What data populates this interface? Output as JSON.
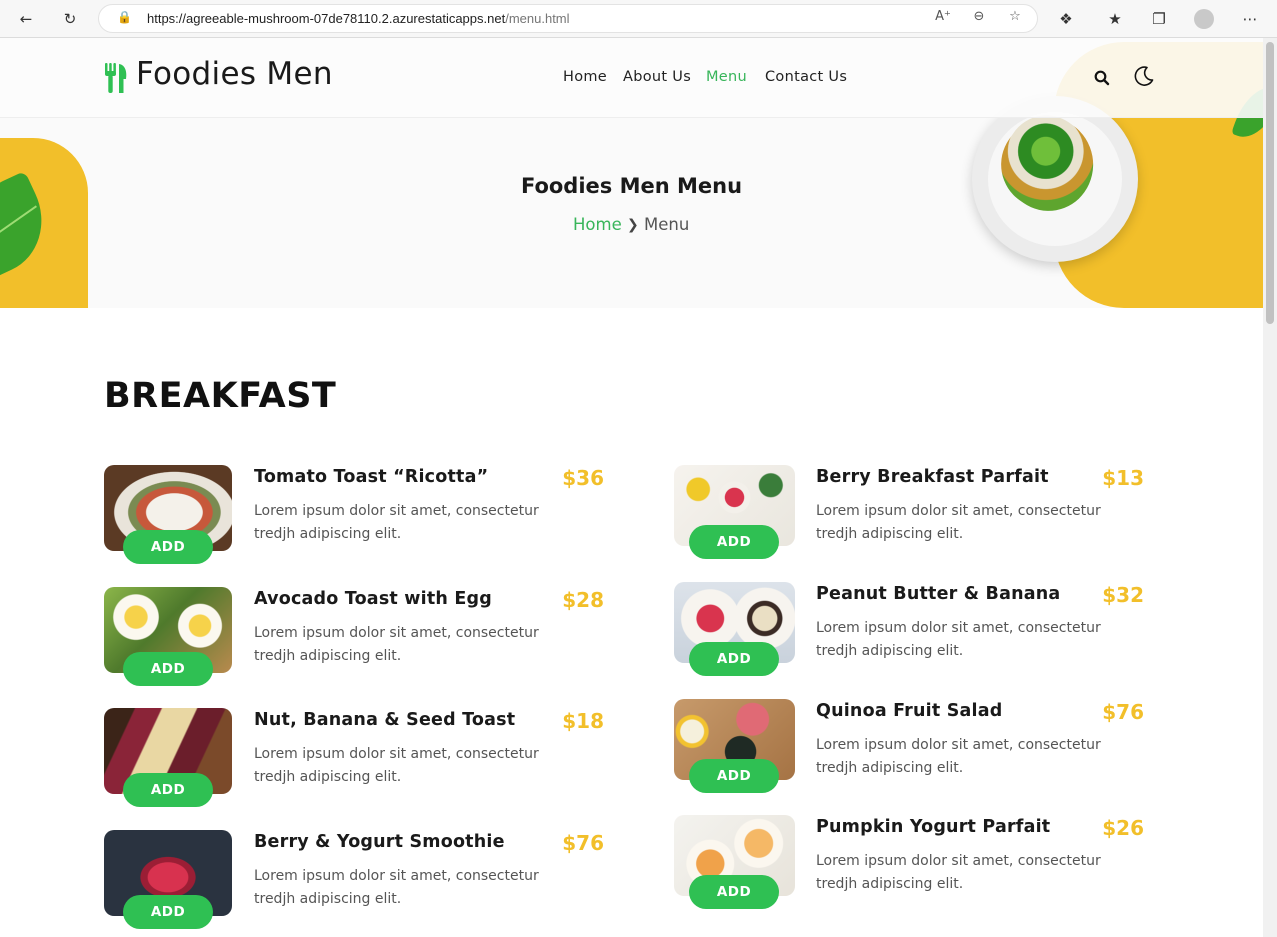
{
  "browser": {
    "url_host": "https://agreeable-mushroom-07de78110.2.azurestaticapps.net",
    "url_path": "/menu.html",
    "icons": [
      "back-icon",
      "refresh-icon",
      "lock-icon",
      "read-aloud-icon",
      "zoom-icon",
      "favorite-add-icon",
      "extensions-icon",
      "favorites-icon",
      "collections-icon",
      "profile-icon",
      "more-icon"
    ]
  },
  "nav": {
    "logo": "Foodies Men",
    "links": [
      "Home",
      "About Us",
      "Menu",
      "Contact Us"
    ],
    "active_link": "Menu"
  },
  "hero": {
    "title": "Foodies Men Menu",
    "breadcrumb_home": "Home",
    "breadcrumb_current": "Menu"
  },
  "menu": {
    "section_title": "BREAKFAST",
    "add_label": "ADD",
    "left": [
      {
        "name": "Tomato Toast “Ricotta”",
        "price": "$36",
        "desc": "Lorem ipsum dolor sit amet, consectetur tredjh adipiscing elit."
      },
      {
        "name": "Avocado Toast with Egg",
        "price": "$28",
        "desc": "Lorem ipsum dolor sit amet, consectetur tredjh adipiscing elit."
      },
      {
        "name": "Nut, Banana & Seed Toast",
        "price": "$18",
        "desc": "Lorem ipsum dolor sit amet, consectetur tredjh adipiscing elit."
      },
      {
        "name": "Berry & Yogurt Smoothie",
        "price": "$76",
        "desc": "Lorem ipsum dolor sit amet, consectetur tredjh adipiscing elit."
      }
    ],
    "right": [
      {
        "name": "Berry Breakfast Parfait",
        "price": "$13",
        "desc": "Lorem ipsum dolor sit amet, consectetur tredjh adipiscing elit."
      },
      {
        "name": "Peanut Butter & Banana",
        "price": "$32",
        "desc": "Lorem ipsum dolor sit amet, consectetur tredjh adipiscing elit."
      },
      {
        "name": "Quinoa Fruit Salad",
        "price": "$76",
        "desc": "Lorem ipsum dolor sit amet, consectetur tredjh adipiscing elit."
      },
      {
        "name": "Pumpkin Yogurt Parfait",
        "price": "$26",
        "desc": "Lorem ipsum dolor sit amet, consectetur tredjh adipiscing elit."
      }
    ]
  },
  "colors": {
    "accent_green": "#2fc053",
    "accent_yellow": "#f2bf2a",
    "text_dark": "#1a1a1a"
  }
}
